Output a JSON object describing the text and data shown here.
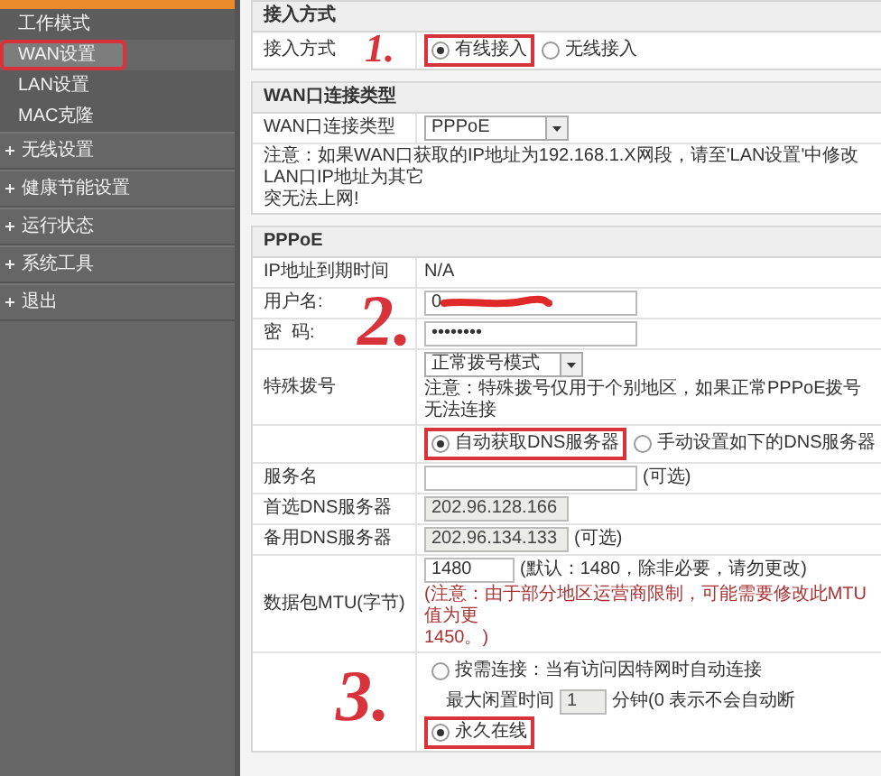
{
  "sidebar": {
    "items": [
      {
        "kind": "sub",
        "label": "工作模式",
        "selected": false,
        "annotated": false
      },
      {
        "kind": "sub",
        "label": "WAN设置",
        "selected": true,
        "annotated": true
      },
      {
        "kind": "sub",
        "label": "LAN设置",
        "selected": false,
        "annotated": false
      },
      {
        "kind": "sub",
        "label": "MAC克隆",
        "selected": false,
        "annotated": false
      },
      {
        "kind": "group",
        "label": "无线设置",
        "selected": false,
        "annotated": false
      },
      {
        "kind": "group",
        "label": "健康节能设置",
        "selected": false,
        "annotated": false
      },
      {
        "kind": "group",
        "label": "运行状态",
        "selected": false,
        "annotated": false
      },
      {
        "kind": "group",
        "label": "系统工具",
        "selected": false,
        "annotated": false
      },
      {
        "kind": "group",
        "label": "退出",
        "selected": false,
        "annotated": false
      }
    ]
  },
  "panels": [
    {
      "title": "接入方式",
      "rows": [
        {
          "kind": "radios",
          "label": "接入方式",
          "annotation": "1.",
          "options": [
            {
              "label": "有线接入",
              "selected": true,
              "annotated": true
            },
            {
              "label": "无线接入",
              "selected": false,
              "annotated": false
            }
          ]
        }
      ]
    },
    {
      "title": "WAN口连接类型",
      "rows": [
        {
          "kind": "select",
          "label": "WAN口连接类型",
          "value": "PPPoE"
        },
        {
          "kind": "note",
          "lines": [
            "注意：如果WAN口获取的IP地址为192.168.1.X网段，请至'LAN设置'中修改LAN口IP地址为其它",
            "突无法上网!"
          ]
        }
      ]
    },
    {
      "title": "PPPoE",
      "rows": [
        {
          "kind": "text",
          "label": "IP地址到期时间",
          "value": "N/A"
        },
        {
          "kind": "input",
          "label": "用户名:",
          "value": "0",
          "redacted": true,
          "annotation": "2.",
          "disabled": false
        },
        {
          "kind": "input",
          "label": "密  码:",
          "value": "••••••••",
          "disabled": false
        },
        {
          "kind": "select",
          "label": "特殊拨号",
          "value": "正常拨号模式",
          "note": "注意：特殊拨号仅用于个别地区，如果正常PPPoE拨号无法连接"
        },
        {
          "kind": "radios",
          "options": [
            {
              "label": "自动获取DNS服务器",
              "selected": true,
              "annotated": true
            },
            {
              "label": "手动设置如下的DNS服务器",
              "selected": false,
              "annotated": false
            }
          ]
        },
        {
          "kind": "input",
          "label": "服务名",
          "hint": "(可选)",
          "disabled": false
        },
        {
          "kind": "input",
          "label": "首选DNS服务器",
          "value": "202.96.128.166",
          "disabled": true
        },
        {
          "kind": "input",
          "label": "备用DNS服务器",
          "value": "202.96.134.133",
          "hint": "(可选)",
          "disabled": true
        },
        {
          "kind": "input",
          "label": "数据包MTU(字节)",
          "value": "1480",
          "hint": "(默认：1480，除非必要，请勿更改)",
          "warning_lines": [
            "(注意：由于部分地区运营商限制，可能需要修改此MTU值为更",
            "1450。)"
          ],
          "disabled": false
        },
        {
          "kind": "connect",
          "annotation": "3.",
          "options": [
            {
              "label": "按需连接：当有访问因特网时自动连接",
              "selected": false,
              "annotated": false,
              "idle_label": "最大闲置时间",
              "idle_value": "1",
              "idle_unit": "分钟(0 表示不会自动断"
            },
            {
              "label": "永久在线",
              "selected": true,
              "annotated": true
            }
          ]
        }
      ]
    }
  ]
}
